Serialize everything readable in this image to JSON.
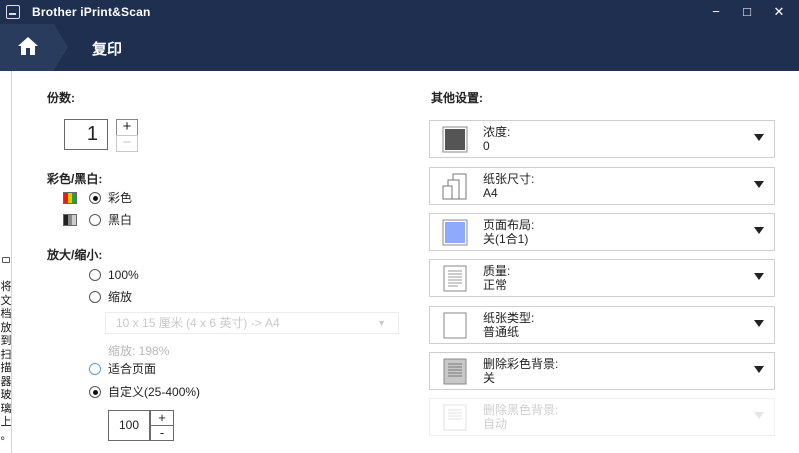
{
  "window": {
    "title": "Brother iPrint&Scan",
    "minimize": "−",
    "maximize": "□",
    "close": "✕"
  },
  "nav": {
    "home_icon": "home-icon",
    "title": "复印"
  },
  "sidebar": {
    "text": [
      "将",
      "文",
      "档",
      "放",
      "到",
      "扫",
      "描",
      "器",
      "玻",
      "璃",
      "上",
      "。"
    ]
  },
  "copies": {
    "label": "份数:",
    "value": "1",
    "plus": "+",
    "minus": "−"
  },
  "color_mode": {
    "label": "彩色/黑白:",
    "options": [
      {
        "label": "彩色",
        "checked": true,
        "icon": "color-icon"
      },
      {
        "label": "黑白",
        "checked": false,
        "icon": "mono-icon"
      }
    ]
  },
  "scaling": {
    "label": "放大/缩小:",
    "opt_100": "100%",
    "opt_zoom": "缩放",
    "zoom_select_value": "10 x 15 厘米 (4 x 6 英寸) -> A4",
    "zoom_percent": "缩放: 198%",
    "opt_fit": "适合页面",
    "opt_custom": "自定义(25-400%)",
    "custom_value": "100",
    "plus": "+",
    "minus": "-",
    "selected": "custom"
  },
  "other_settings": {
    "label": "其他设置:",
    "items": [
      {
        "label": "浓度:",
        "value": "0",
        "icon": "density-icon",
        "enabled": true
      },
      {
        "label": "纸张尺寸:",
        "value": "A4",
        "icon": "paper-size-icon",
        "enabled": true
      },
      {
        "label": "页面布局:",
        "value": "关(1合1)",
        "icon": "page-layout-icon",
        "enabled": true
      },
      {
        "label": "质量:",
        "value": "正常",
        "icon": "quality-icon",
        "enabled": true
      },
      {
        "label": "纸张类型:",
        "value": "普通纸",
        "icon": "paper-type-icon",
        "enabled": true
      },
      {
        "label": "删除彩色背景:",
        "value": "关",
        "icon": "remove-color-bg-icon",
        "enabled": true
      },
      {
        "label": "删除黑色背景:",
        "value": "自动",
        "icon": "remove-black-bg-icon",
        "enabled": false
      }
    ]
  },
  "colors": {
    "titlebar": "#1e2f4f",
    "home_button": "#2a3c5e",
    "density_swatch": "#555555",
    "layout_swatch": "#8ea9ff"
  }
}
